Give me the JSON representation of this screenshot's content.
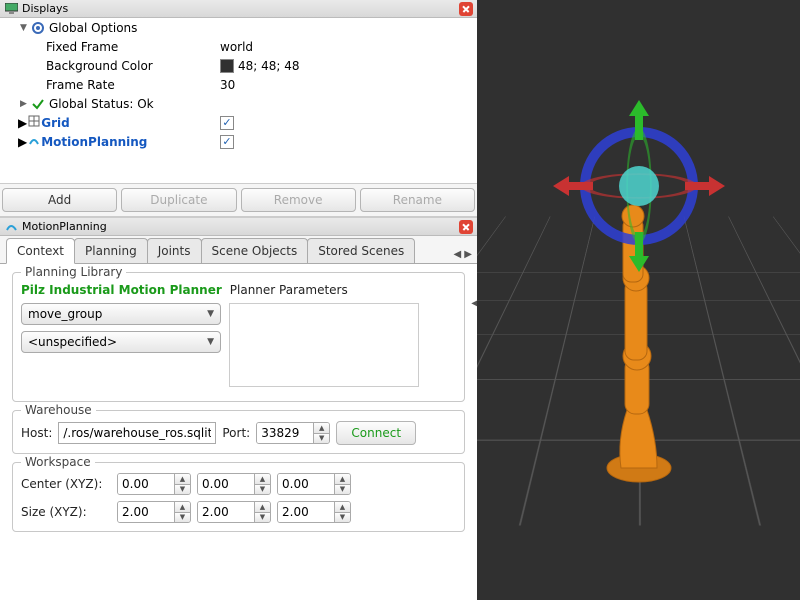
{
  "displays_panel": {
    "title": "Displays",
    "global_options": {
      "label": "Global Options",
      "fixed_frame": {
        "label": "Fixed Frame",
        "value": "world"
      },
      "background_color": {
        "label": "Background Color",
        "value": "48; 48; 48",
        "hex": "#303030"
      },
      "frame_rate": {
        "label": "Frame Rate",
        "value": "30"
      }
    },
    "global_status": {
      "label": "Global Status: Ok"
    },
    "items": [
      {
        "label": "Grid",
        "checked": true
      },
      {
        "label": "MotionPlanning",
        "checked": true
      }
    ]
  },
  "display_buttons": {
    "add": "Add",
    "duplicate": "Duplicate",
    "remove": "Remove",
    "rename": "Rename"
  },
  "motion_panel": {
    "title": "MotionPlanning",
    "tabs": [
      "Context",
      "Planning",
      "Joints",
      "Scene Objects",
      "Stored Scenes"
    ],
    "active_tab": "Context",
    "planning_library": {
      "title": "Planning Library",
      "planner_name": "Pilz Industrial Motion Planner",
      "parameters_label": "Planner Parameters",
      "group_combo": "move_group",
      "planner_combo": "<unspecified>"
    },
    "warehouse": {
      "title": "Warehouse",
      "host_label": "Host:",
      "host_value": "/.ros/warehouse_ros.sqlite",
      "port_label": "Port:",
      "port_value": "33829",
      "connect_label": "Connect"
    },
    "workspace": {
      "title": "Workspace",
      "center_label": "Center (XYZ):",
      "center": [
        "0.00",
        "0.00",
        "0.00"
      ],
      "size_label": "Size (XYZ):",
      "size": [
        "2.00",
        "2.00",
        "2.00"
      ]
    }
  },
  "viewport": {
    "background": "#303030",
    "robot_color": "#e88a1a",
    "gizmo_colors": {
      "x": "#c83232",
      "y": "#2bbb2b",
      "z": "#3c6cff",
      "ring": "#2e3fd6"
    }
  }
}
